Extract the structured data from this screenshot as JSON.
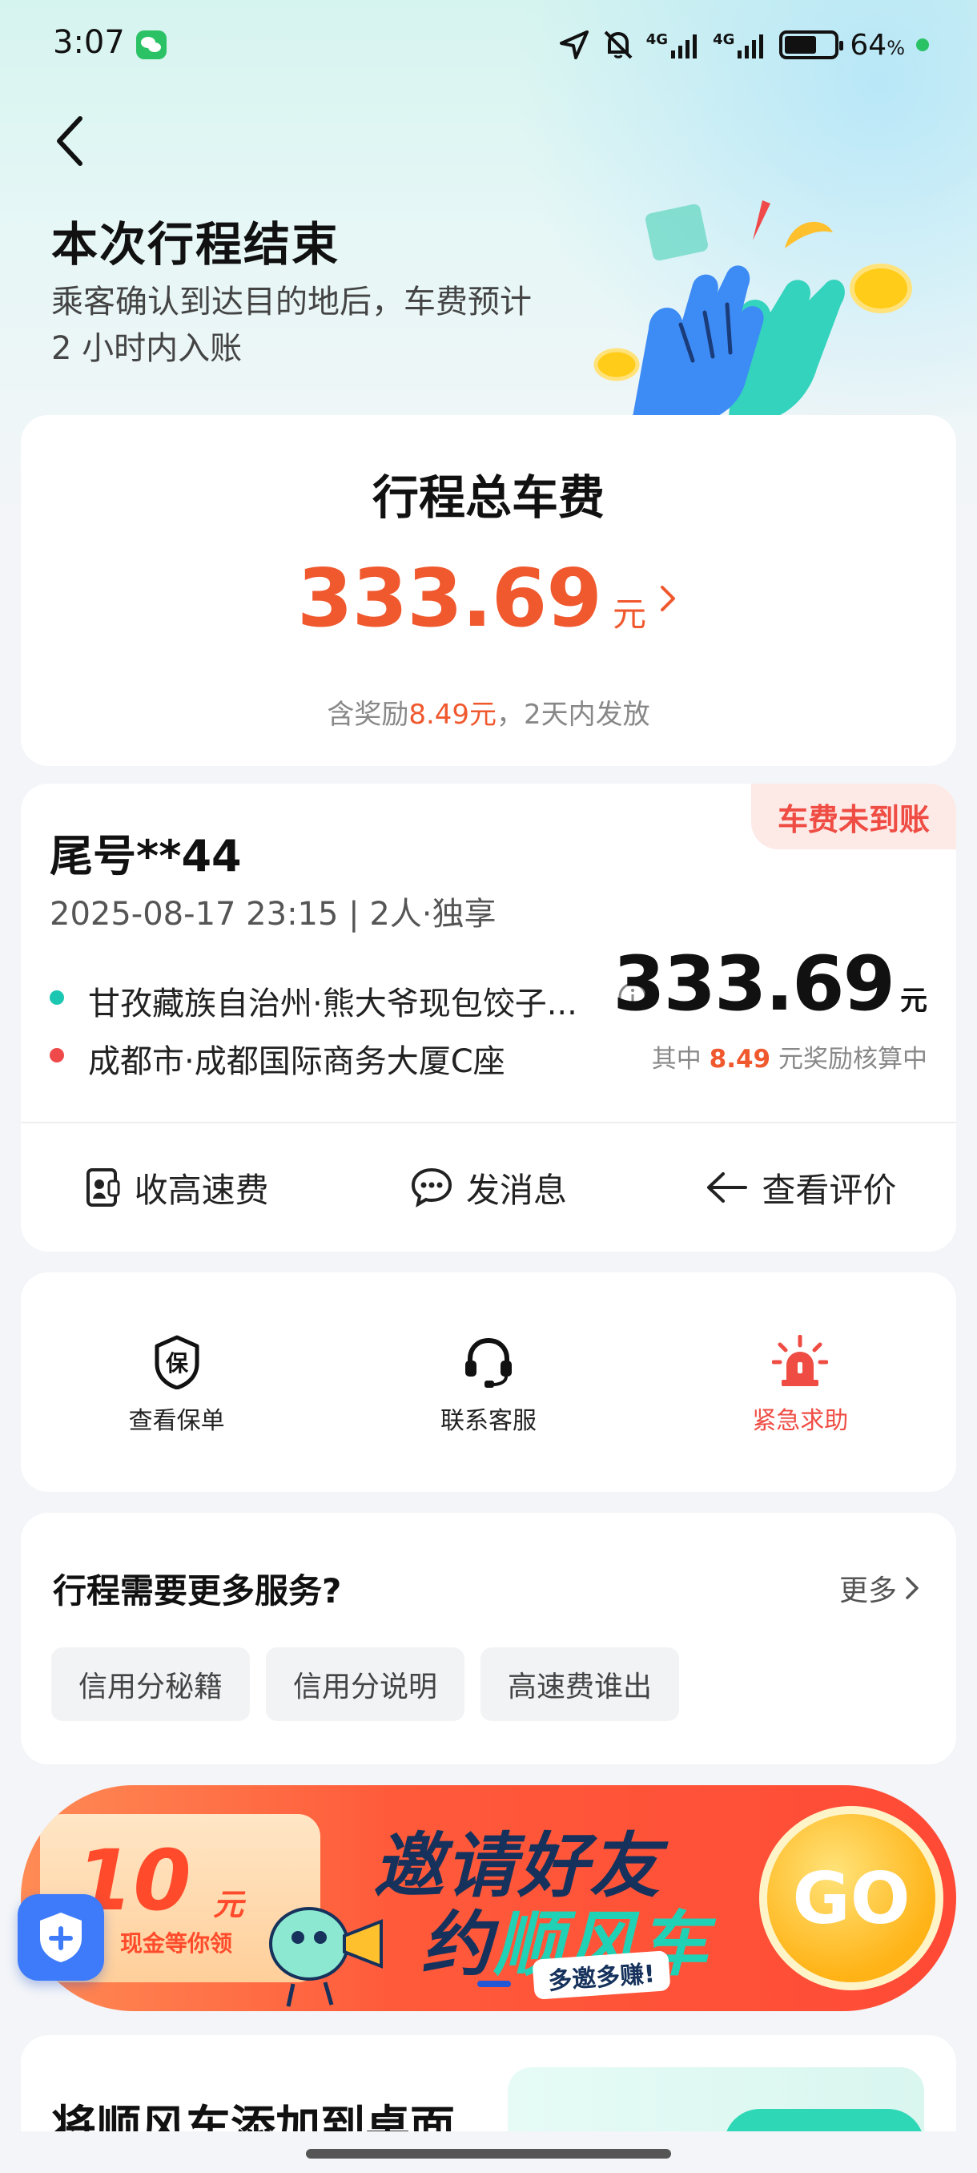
{
  "status_bar": {
    "time": "3:07",
    "network1": "4G",
    "network2": "4G",
    "battery_percent": "64",
    "battery_unit": "%",
    "battery_level": 0.64
  },
  "header": {
    "title": "本次行程结束",
    "subtitle": "乘客确认到达目的地后，车费预计 2 小时内入账"
  },
  "fare": {
    "title": "行程总车费",
    "amount": "333.69",
    "unit": "元",
    "note_prefix": "含奖励",
    "note_bonus": "8.49元",
    "note_suffix": "，2天内发放"
  },
  "trip": {
    "status_badge": "车费未到账",
    "plate": "尾号**44",
    "meta": "2025-08-17 23:15 | 2人·独享",
    "from": "甘孜藏族自治州·熊大爷现包饺子...",
    "to": "成都市·成都国际商务大厦C座",
    "amount": "333.69",
    "unit": "元",
    "sub_prefix": "其中",
    "sub_bonus": "8.49",
    "sub_suffix": "元奖励核算中",
    "actions": [
      {
        "label": "收高速费",
        "icon": "toll-receipt-icon"
      },
      {
        "label": "发消息",
        "icon": "message-bubble-icon"
      },
      {
        "label": "查看评价",
        "icon": "arrow-left-icon"
      }
    ]
  },
  "quick_actions": [
    {
      "label": "查看保单",
      "icon": "insurance-shield-icon",
      "badge": "保"
    },
    {
      "label": "联系客服",
      "icon": "headset-icon"
    },
    {
      "label": "紧急求助",
      "icon": "alarm-siren-icon"
    }
  ],
  "services": {
    "title": "行程需要更多服务?",
    "more": "更多",
    "chips": [
      "信用分秘籍",
      "信用分说明",
      "高速费谁出"
    ]
  },
  "banner": {
    "coupon_amount": "10",
    "coupon_unit": "元",
    "coupon_note": "现金等你领",
    "title_line1": "邀请好友",
    "title_line2_a": "约",
    "title_line2_b": "顺风车",
    "tag": "多邀多赚!",
    "go": "GO"
  },
  "add_to_desktop": {
    "title": "将顺风车添加到桌面"
  },
  "colors": {
    "accent": "#f0582e",
    "alert": "#ef4d44",
    "teal": "#1cc7b1",
    "blue": "#3d7bfa"
  }
}
